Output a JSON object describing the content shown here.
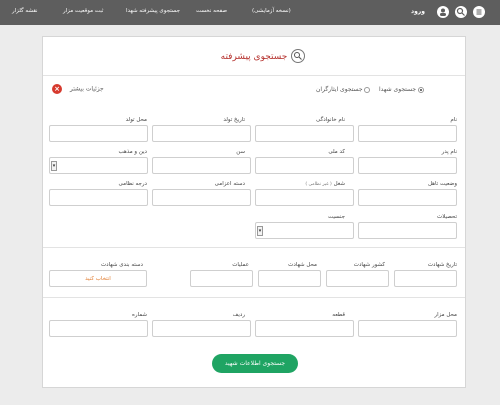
{
  "topbar": {
    "nav": [
      "نقشه گلزار",
      "ثبت موقعیت مزار",
      "جستجوی پیشرفته شهدا",
      "صفحه نخست",
      "(نسخه آزمایشی)"
    ],
    "login": "ورود",
    "icons": [
      "search-icon",
      "menu-icon"
    ]
  },
  "search": {
    "title": "جستجوی پیشرفته",
    "radio_martyrs": "جستجوی شهدا",
    "radio_veterans": "جستجوی ایثارگران",
    "more_details": "جزئیات بیشتر",
    "submit": "جستجوی اطلاعات شهید"
  },
  "labels": {
    "name": "نام",
    "family": "نام خانوادگی",
    "birth_date": "تاریخ تولد",
    "birth_place": "محل تولد",
    "father": "نام پدر",
    "national_code": "کد ملی",
    "age": "سن",
    "religion": "دین و مذهب",
    "marital": "وضعیت تاهل",
    "job": "شغل",
    "job_note": "( غیر نظامی )",
    "force": "دسته اعزامی",
    "rank": "درجه نظامی",
    "education": "تحصیلات",
    "gender": "جنسیت",
    "martyr_date": "تاریخ شهادت",
    "martyr_country": "کشور شهادت",
    "martyr_place": "محل شهادت",
    "operations": "عملیات",
    "category": "دسته بندی شهادت",
    "category_value": "انتخاب کنید",
    "grave_place": "محل مزار",
    "piece": "قطعه",
    "row": "ردیف",
    "number": "شماره"
  }
}
